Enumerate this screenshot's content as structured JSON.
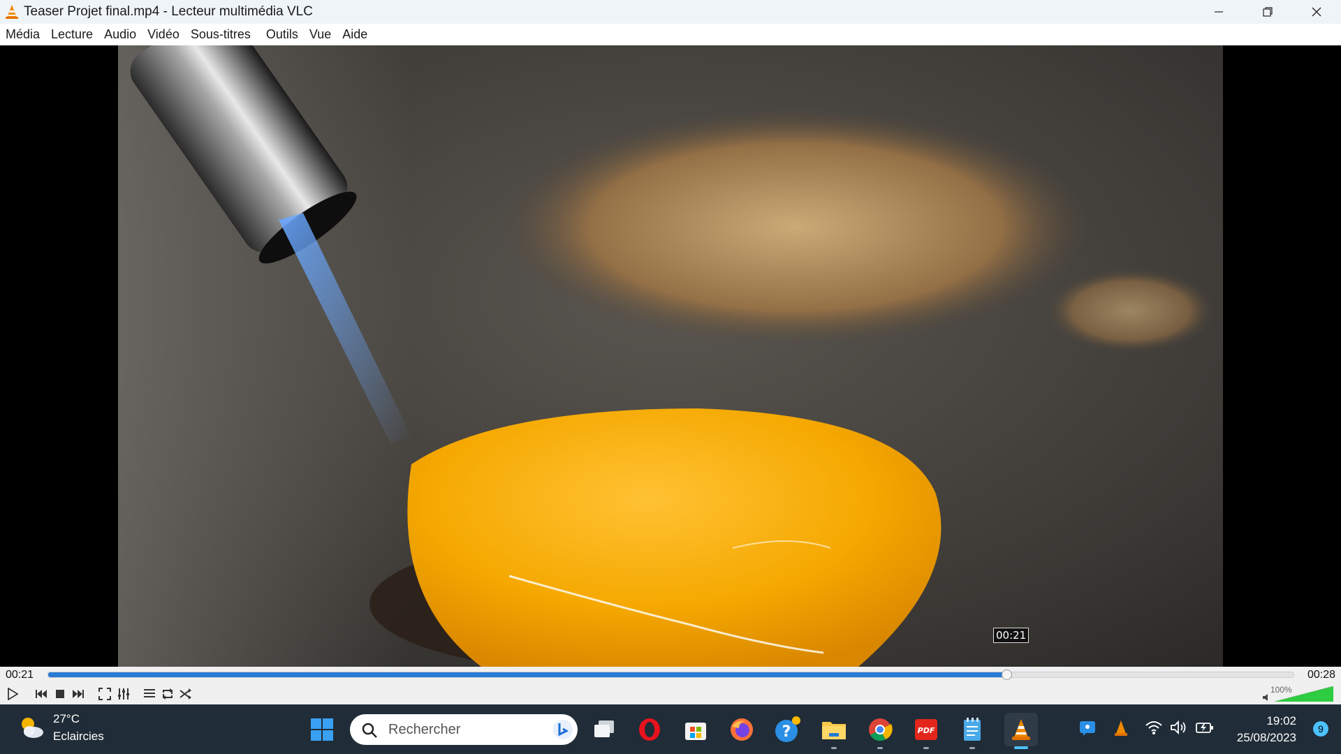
{
  "window": {
    "title": "Teaser Projet final.mp4 - Lecteur multimédia VLC",
    "controls": [
      "minimize-icon",
      "restore-icon",
      "close-icon"
    ]
  },
  "menu": {
    "items": [
      "Média",
      "Lecture",
      "Audio",
      "Vidéo",
      "Sous-titres",
      "Outils",
      "Vue",
      "Aide"
    ]
  },
  "video": {
    "hover_time": "00:21",
    "scene": "cheese-melting-torch"
  },
  "player": {
    "elapsed": "00:21",
    "duration": "00:28",
    "progress_fraction": 0.77,
    "volume_label": "100%",
    "volume_fraction": 1.0,
    "accent_color": "#2a7bd3",
    "buttons": [
      "play-icon",
      "previous-icon",
      "stop-icon",
      "next-icon",
      "fullscreen-icon",
      "extended-settings-icon",
      "playlist-icon",
      "loop-icon",
      "shuffle-icon"
    ]
  },
  "taskbar": {
    "weather": {
      "temperature": "27°C",
      "condition": "Eclaircies"
    },
    "search_placeholder": "Rechercher",
    "apps": [
      "windows-start-icon",
      "task-view-icon",
      "opera-icon",
      "microsoft-store-icon",
      "firefox-icon",
      "help-icon",
      "file-explorer-icon",
      "chrome-icon",
      "pdf-icon",
      "notepad-icon",
      "vlc-icon"
    ],
    "clock": {
      "time": "19:02",
      "date": "25/08/2023"
    },
    "notifications": "9"
  }
}
